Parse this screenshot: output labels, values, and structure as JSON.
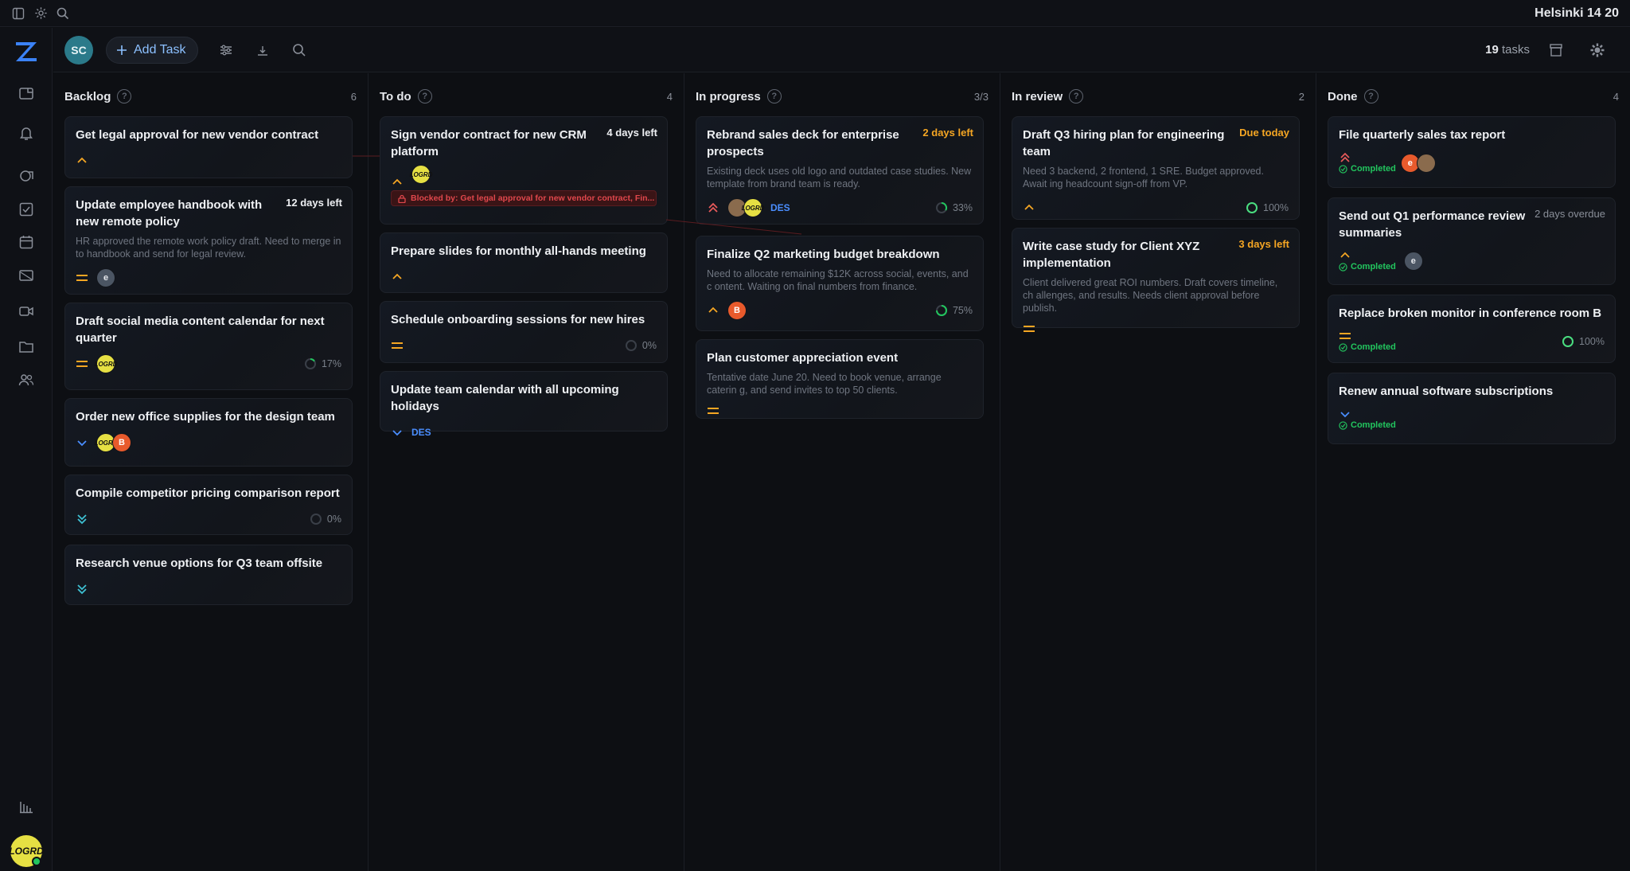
{
  "window": {
    "clock": "Helsinki  14 20"
  },
  "user": {
    "initials": "SC",
    "avatar_label": "LOGRD"
  },
  "toolbar": {
    "add_task_label": "Add Task",
    "task_count_number": "19",
    "task_count_suffix": " tasks"
  },
  "colors": {
    "accent": "#4a8eff",
    "orange": "#f5a623",
    "green": "#22c55e",
    "red": "#e0474c"
  },
  "columns": [
    {
      "title": "Backlog",
      "count": "6"
    },
    {
      "title": "To do",
      "count": "4"
    },
    {
      "title": "In progress",
      "count": "3/3"
    },
    {
      "title": "In review",
      "count": "2"
    },
    {
      "title": "Done",
      "count": "4"
    }
  ],
  "backlog": [
    {
      "title": "Get legal approval for new vendor contract"
    },
    {
      "title": "Update employee handbook with new remote policy",
      "due": "12 days left",
      "desc": "HR approved the remote work policy draft. Need to merge in to handbook and send for legal review.",
      "avatars": [
        "e"
      ]
    },
    {
      "title": "Draft social media content calendar for next quarter",
      "avatars": [
        "LOGRD"
      ],
      "progress": "17%"
    },
    {
      "title": "Order new office supplies for the design team",
      "avatars": [
        "LOGRD",
        "B"
      ]
    },
    {
      "title": "Compile competitor pricing comparison report",
      "progress": "0%"
    },
    {
      "title": "Research venue options for Q3 team offsite"
    }
  ],
  "todo": [
    {
      "title": "Sign vendor contract for new CRM platform",
      "due": "4 days left",
      "avatars": [
        "LOGRD"
      ],
      "blocked": "Blocked by: Get legal approval for new vendor contract, Fin..."
    },
    {
      "title": "Prepare slides for monthly all-hands meeting"
    },
    {
      "title": "Schedule onboarding sessions for new hires",
      "progress": "0%"
    },
    {
      "title": "Update team calendar with all upcoming holidays",
      "tag": "DES"
    }
  ],
  "inprogress": [
    {
      "title": "Rebrand sales deck for enterprise prospects",
      "due": "2 days left",
      "desc": "Existing deck uses old logo and outdated case studies. New template from brand team is ready.",
      "avatars": [
        "LOGRD"
      ],
      "tag": "DES",
      "progress": "33%"
    },
    {
      "title": "Finalize Q2 marketing budget breakdown",
      "desc": "Need to allocate remaining $12K across social, events, and c ontent. Waiting on final numbers from finance.",
      "avatars": [
        "B"
      ],
      "progress": "75%"
    },
    {
      "title": "Plan customer appreciation event",
      "desc": "Tentative date June 20. Need to book venue, arrange caterin g, and send invites to top 50 clients."
    }
  ],
  "inreview": [
    {
      "title": "Draft Q3 hiring plan for engineering team",
      "due": "Due today",
      "desc": "Need 3 backend, 2 frontend, 1 SRE. Budget approved. Await ing headcount sign-off from VP.",
      "progress": "100%"
    },
    {
      "title": "Write case study for Client XYZ implementation",
      "due": "3 days left",
      "desc": "Client delivered great ROI numbers. Draft covers timeline, ch allenges, and results. Needs client approval before publish."
    }
  ],
  "done": [
    {
      "title": "File quarterly sales tax report",
      "status": "Completed",
      "avatars": [
        "e",
        ""
      ]
    },
    {
      "title": "Send out Q1 performance review summaries",
      "due": "2 days overdue",
      "status": "Completed",
      "avatars": [
        "e"
      ]
    },
    {
      "title": "Replace broken monitor in conference room B",
      "status": "Completed",
      "progress": "100%"
    },
    {
      "title": "Renew annual software subscriptions",
      "status": "Completed"
    }
  ]
}
